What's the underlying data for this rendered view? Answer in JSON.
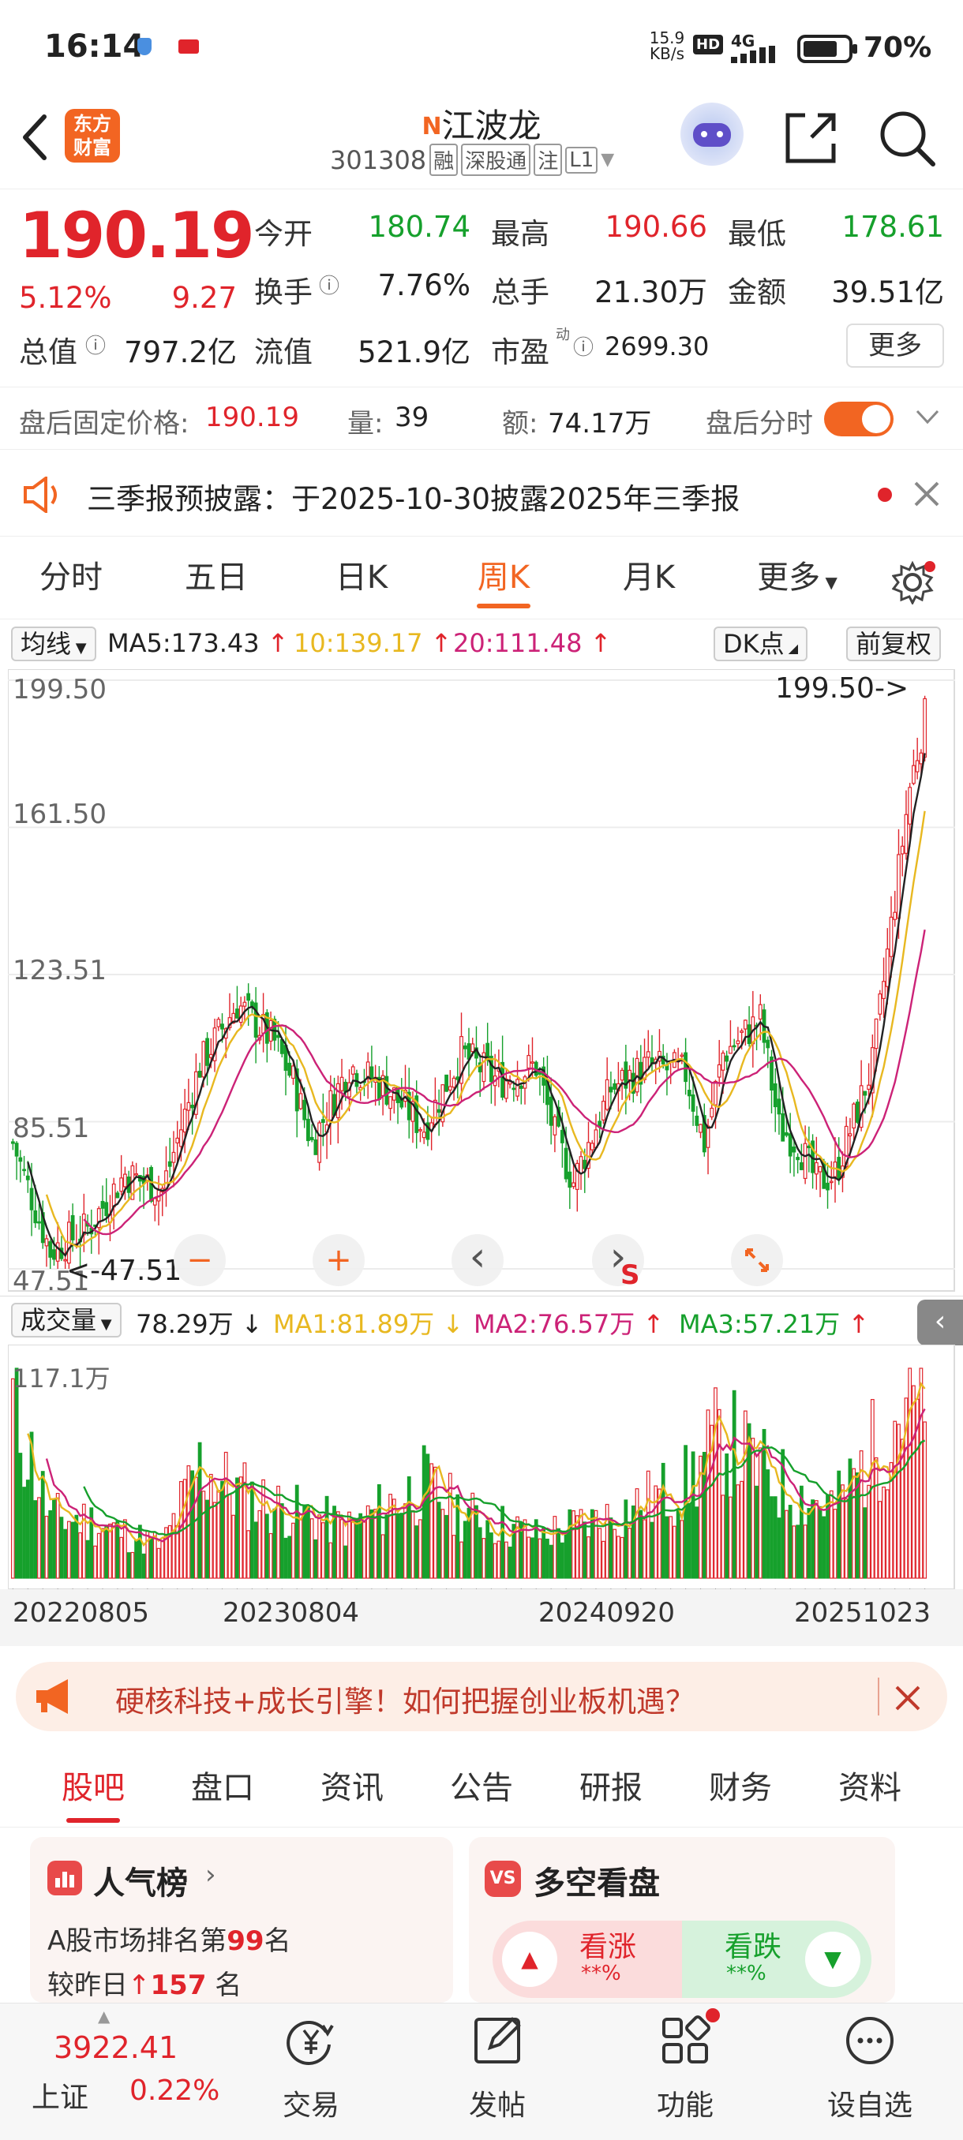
{
  "status_bar": {
    "time": "16:14",
    "net_speed_value": "15.9",
    "net_speed_unit": "KB/s",
    "hd": "HD",
    "network": "4G",
    "battery": "70%"
  },
  "header": {
    "brand_line1": "东方",
    "brand_line2": "财富",
    "n_mark": "N",
    "stock_name": "江波龙",
    "stock_code": "301308",
    "tags": [
      "融",
      "深股通",
      "注",
      "L1"
    ]
  },
  "quote": {
    "price": "190.19",
    "change_pct": "5.12%",
    "change": "9.27",
    "open_label": "今开",
    "open": "180.74",
    "high_label": "最高",
    "high": "190.66",
    "low_label": "最低",
    "low": "178.61",
    "turnover_label": "换手",
    "turnover": "7.76%",
    "volume_label": "总手",
    "volume": "21.30万",
    "amount_label": "金额",
    "amount": "39.51亿",
    "mktcap_label": "总值",
    "mktcap": "797.2亿",
    "float_label": "流值",
    "float_cap": "521.9亿",
    "pe_label": "市盈",
    "pe_sup": "动",
    "pe": "2699.30",
    "more_label": "更多"
  },
  "after_hours": {
    "price_label": "盘后固定价格:",
    "price": "190.19",
    "qty_label": "量:",
    "qty": "39",
    "amt_label": "额:",
    "amt": "74.17万",
    "tick_label": "盘后分时"
  },
  "notice": {
    "text": "三季报预披露：于2025-10-30披露2025年三季报"
  },
  "chart_tabs": [
    {
      "label": "分时"
    },
    {
      "label": "五日"
    },
    {
      "label": "日K"
    },
    {
      "label": "周K"
    },
    {
      "label": "月K"
    },
    {
      "label": "更多"
    }
  ],
  "active_tab": "周K",
  "indicators": {
    "ma_select": "均线",
    "ma5": "MA5:173.43",
    "ma10": "10:139.17",
    "ma20": "20:111.48",
    "dk_label": "DK点",
    "adj_label": "前复权",
    "ma5_color": "#222222",
    "ma10_color": "#e8b820",
    "ma20_color": "#cc2277"
  },
  "volume_indicators": {
    "select": "成交量",
    "vol": "78.29万",
    "ma1": "MA1:81.89万",
    "ma2": "MA2:76.57万",
    "ma3": "MA3:57.21万",
    "ma1_color": "#e8b820",
    "ma2_color": "#cc2277",
    "ma3_color": "#16a02c",
    "max_label": "117.1万"
  },
  "chart_data": [
    {
      "type": "candlestick",
      "title": "",
      "y_ticks": [
        "199.50",
        "161.50",
        "123.51",
        "85.51",
        "47.51"
      ],
      "ylim": [
        47.51,
        199.5
      ],
      "high_marker": "199.50->",
      "low_marker": "47.51",
      "x_ticks": [
        "20220805",
        "20230804",
        "20240920",
        "20251023"
      ],
      "grid": true,
      "series": [
        {
          "name": "MA5"
        },
        {
          "name": "MA10"
        },
        {
          "name": "MA20"
        }
      ],
      "close_trend": [
        [
          0,
          80
        ],
        [
          10,
          52
        ],
        [
          20,
          58
        ],
        [
          30,
          72
        ],
        [
          40,
          68
        ],
        [
          50,
          100
        ],
        [
          60,
          116
        ],
        [
          70,
          106
        ],
        [
          75,
          96
        ],
        [
          80,
          80
        ],
        [
          90,
          100
        ],
        [
          100,
          94
        ],
        [
          110,
          84
        ],
        [
          120,
          103
        ],
        [
          130,
          96
        ],
        [
          140,
          100
        ],
        [
          145,
          82
        ],
        [
          150,
          70
        ],
        [
          160,
          94
        ],
        [
          170,
          100
        ],
        [
          180,
          98
        ],
        [
          185,
          80
        ],
        [
          190,
          103
        ],
        [
          200,
          112
        ],
        [
          205,
          84
        ],
        [
          210,
          80
        ],
        [
          215,
          70
        ],
        [
          220,
          72
        ],
        [
          230,
          100
        ],
        [
          240,
          172
        ],
        [
          244,
          190
        ]
      ]
    },
    {
      "type": "bar",
      "title": "",
      "ylim": [
        0,
        117.1
      ],
      "unit": "万",
      "max_label": "117.1万",
      "volume_trend": [
        [
          0,
          98
        ],
        [
          10,
          34
        ],
        [
          20,
          32
        ],
        [
          40,
          18
        ],
        [
          50,
          62
        ],
        [
          60,
          48
        ],
        [
          70,
          40
        ],
        [
          90,
          28
        ],
        [
          110,
          52
        ],
        [
          120,
          36
        ],
        [
          140,
          24
        ],
        [
          160,
          34
        ],
        [
          180,
          52
        ],
        [
          190,
          80
        ],
        [
          200,
          60
        ],
        [
          210,
          46
        ],
        [
          220,
          40
        ],
        [
          230,
          70
        ],
        [
          240,
          105
        ],
        [
          244,
          78
        ]
      ]
    }
  ],
  "chart_controls": {
    "minus": "−",
    "plus": "+",
    "prev": "‹",
    "next": "›",
    "s_mark": "S"
  },
  "banner": {
    "text": "硬核科技+成长引擎！如何把握创业板机遇？"
  },
  "bottom_tabs": [
    {
      "label": "股吧"
    },
    {
      "label": "盘口"
    },
    {
      "label": "资讯"
    },
    {
      "label": "公告"
    },
    {
      "label": "研报"
    },
    {
      "label": "财务"
    },
    {
      "label": "资料"
    }
  ],
  "cards": {
    "popularity": {
      "title": "人气榜",
      "rank_prefix": "A股市场排名第",
      "rank": "99",
      "rank_suffix": "名",
      "change_prefix": "较昨日",
      "change": "157",
      "change_suffix": "名"
    },
    "sentiment": {
      "title": "多空看盘",
      "bull": "看涨",
      "bull_pct": "**%",
      "bear": "看跌",
      "bear_pct": "**%"
    }
  },
  "bottom_nav": {
    "index_value": "3922.41",
    "index_name": "上证",
    "index_change": "0.22%",
    "items": [
      {
        "label": "交易"
      },
      {
        "label": "发帖"
      },
      {
        "label": "功能"
      },
      {
        "label": "设自选"
      }
    ]
  }
}
